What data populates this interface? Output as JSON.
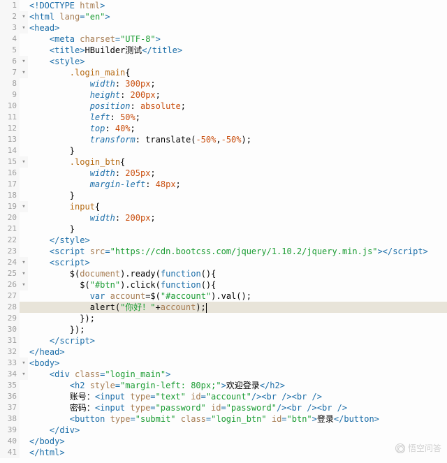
{
  "watermark": "悟空问答",
  "numbers": [
    "1",
    "2",
    "3",
    "4",
    "5",
    "6",
    "7",
    "8",
    "9",
    "10",
    "11",
    "12",
    "13",
    "14",
    "15",
    "16",
    "17",
    "18",
    "19",
    "20",
    "21",
    "22",
    "23",
    "24",
    "25",
    "26",
    "27",
    "28",
    "29",
    "30",
    "31",
    "32",
    "33",
    "34",
    "35",
    "36",
    "37",
    "38",
    "39",
    "40",
    "41"
  ],
  "fold": [
    0,
    1,
    1,
    0,
    0,
    1,
    1,
    0,
    0,
    0,
    0,
    0,
    0,
    0,
    1,
    0,
    0,
    0,
    1,
    0,
    0,
    0,
    0,
    1,
    1,
    1,
    0,
    0,
    0,
    0,
    0,
    0,
    1,
    1,
    0,
    0,
    0,
    0,
    0,
    0,
    0
  ],
  "current": 27,
  "lines": [
    [
      [
        "t-tag",
        "<!DOCTYPE "
      ],
      [
        "t-attr",
        "html"
      ],
      [
        "t-tag",
        ">"
      ]
    ],
    [
      [
        "t-tag",
        "<html "
      ],
      [
        "t-attr",
        "lang"
      ],
      [
        "t-tag",
        "="
      ],
      [
        "t-str",
        "\"en\""
      ],
      [
        "t-tag",
        ">"
      ]
    ],
    [
      [
        "t-tag",
        "<head>"
      ]
    ],
    [
      [
        "t-plain",
        "    "
      ],
      [
        "t-tag",
        "<meta "
      ],
      [
        "t-attr",
        "charset"
      ],
      [
        "t-tag",
        "="
      ],
      [
        "t-str",
        "\"UTF-8\""
      ],
      [
        "t-tag",
        ">"
      ]
    ],
    [
      [
        "t-plain",
        "    "
      ],
      [
        "t-tag",
        "<title>"
      ],
      [
        "t-plain",
        "HBuilder测试"
      ],
      [
        "t-tag",
        "</title>"
      ]
    ],
    [
      [
        "t-plain",
        "    "
      ],
      [
        "t-tag",
        "<style>"
      ]
    ],
    [
      [
        "t-plain",
        "        "
      ],
      [
        "t-sel",
        ".login_main"
      ],
      [
        "t-punct",
        "{"
      ]
    ],
    [
      [
        "t-plain",
        "            "
      ],
      [
        "t-prop",
        "width"
      ],
      [
        "t-punct",
        ": "
      ],
      [
        "t-num",
        "300"
      ],
      [
        "t-val",
        "px"
      ],
      [
        "t-punct",
        ";"
      ]
    ],
    [
      [
        "t-plain",
        "            "
      ],
      [
        "t-prop",
        "height"
      ],
      [
        "t-punct",
        ": "
      ],
      [
        "t-num",
        "200"
      ],
      [
        "t-val",
        "px"
      ],
      [
        "t-punct",
        ";"
      ]
    ],
    [
      [
        "t-plain",
        "            "
      ],
      [
        "t-prop",
        "position"
      ],
      [
        "t-punct",
        ": "
      ],
      [
        "t-val",
        "absolute"
      ],
      [
        "t-punct",
        ";"
      ]
    ],
    [
      [
        "t-plain",
        "            "
      ],
      [
        "t-prop",
        "left"
      ],
      [
        "t-punct",
        ": "
      ],
      [
        "t-num",
        "50"
      ],
      [
        "t-val",
        "%"
      ],
      [
        "t-punct",
        ";"
      ]
    ],
    [
      [
        "t-plain",
        "            "
      ],
      [
        "t-prop",
        "top"
      ],
      [
        "t-punct",
        ": "
      ],
      [
        "t-num",
        "40"
      ],
      [
        "t-val",
        "%"
      ],
      [
        "t-punct",
        ";"
      ]
    ],
    [
      [
        "t-plain",
        "            "
      ],
      [
        "t-prop",
        "transform"
      ],
      [
        "t-punct",
        ": "
      ],
      [
        "t-func",
        "translate"
      ],
      [
        "t-punct",
        "("
      ],
      [
        "t-num",
        "-50"
      ],
      [
        "t-val",
        "%"
      ],
      [
        "t-punct",
        ","
      ],
      [
        "t-num",
        "-50"
      ],
      [
        "t-val",
        "%"
      ],
      [
        "t-punct",
        ");"
      ]
    ],
    [
      [
        "t-plain",
        "        "
      ],
      [
        "t-punct",
        "}"
      ]
    ],
    [
      [
        "t-plain",
        "        "
      ],
      [
        "t-sel",
        ".login_btn"
      ],
      [
        "t-punct",
        "{"
      ]
    ],
    [
      [
        "t-plain",
        "            "
      ],
      [
        "t-prop",
        "width"
      ],
      [
        "t-punct",
        ": "
      ],
      [
        "t-num",
        "205"
      ],
      [
        "t-val",
        "px"
      ],
      [
        "t-punct",
        ";"
      ]
    ],
    [
      [
        "t-plain",
        "            "
      ],
      [
        "t-prop",
        "margin-left"
      ],
      [
        "t-punct",
        ": "
      ],
      [
        "t-num",
        "48"
      ],
      [
        "t-val",
        "px"
      ],
      [
        "t-punct",
        ";"
      ]
    ],
    [
      [
        "t-plain",
        "        "
      ],
      [
        "t-punct",
        "}"
      ]
    ],
    [
      [
        "t-plain",
        "        "
      ],
      [
        "t-sel",
        "input"
      ],
      [
        "t-punct",
        "{"
      ]
    ],
    [
      [
        "t-plain",
        "            "
      ],
      [
        "t-prop",
        "width"
      ],
      [
        "t-punct",
        ": "
      ],
      [
        "t-num",
        "200"
      ],
      [
        "t-val",
        "px"
      ],
      [
        "t-punct",
        ";"
      ]
    ],
    [
      [
        "t-plain",
        "        "
      ],
      [
        "t-punct",
        "}"
      ]
    ],
    [
      [
        "t-plain",
        "    "
      ],
      [
        "t-tag",
        "</style>"
      ]
    ],
    [
      [
        "t-plain",
        "    "
      ],
      [
        "t-tag",
        "<script "
      ],
      [
        "t-attr",
        "src"
      ],
      [
        "t-tag",
        "="
      ],
      [
        "t-str",
        "\"https://cdn.bootcss.com/jquery/1.10.2/jquery.min.js\""
      ],
      [
        "t-tag",
        "></script>"
      ]
    ],
    [
      [
        "t-plain",
        "    "
      ],
      [
        "t-tag",
        "<script>"
      ]
    ],
    [
      [
        "t-plain",
        "        "
      ],
      [
        "t-func",
        "$"
      ],
      [
        "t-punct",
        "("
      ],
      [
        "t-var",
        "document"
      ],
      [
        "t-punct",
        ")."
      ],
      [
        "t-func",
        "ready"
      ],
      [
        "t-punct",
        "("
      ],
      [
        "t-kw",
        "function"
      ],
      [
        "t-punct",
        "(){"
      ]
    ],
    [
      [
        "t-plain",
        "          "
      ],
      [
        "t-func",
        "$"
      ],
      [
        "t-punct",
        "("
      ],
      [
        "t-str",
        "\"#btn\""
      ],
      [
        "t-punct",
        ")."
      ],
      [
        "t-func",
        "click"
      ],
      [
        "t-punct",
        "("
      ],
      [
        "t-kw",
        "function"
      ],
      [
        "t-punct",
        "(){"
      ]
    ],
    [
      [
        "t-plain",
        "            "
      ],
      [
        "t-kw",
        "var "
      ],
      [
        "t-var",
        "account"
      ],
      [
        "t-punct",
        "="
      ],
      [
        "t-func",
        "$"
      ],
      [
        "t-punct",
        "("
      ],
      [
        "t-str",
        "\"#account\""
      ],
      [
        "t-punct",
        ")."
      ],
      [
        "t-func",
        "val"
      ],
      [
        "t-punct",
        "();"
      ]
    ],
    [
      [
        "t-plain",
        "            "
      ],
      [
        "t-func",
        "alert"
      ],
      [
        "t-punct",
        "("
      ],
      [
        "t-str",
        "\"你好！\""
      ],
      [
        "t-punct",
        "+"
      ],
      [
        "t-var",
        "account"
      ],
      [
        "t-punct",
        ");"
      ],
      [
        "cursor",
        ""
      ]
    ],
    [
      [
        "t-plain",
        "          "
      ],
      [
        "t-punct",
        "});"
      ]
    ],
    [
      [
        "t-plain",
        "        "
      ],
      [
        "t-punct",
        "});"
      ]
    ],
    [
      [
        "t-plain",
        "    "
      ],
      [
        "t-tag",
        "</script>"
      ]
    ],
    [
      [
        "t-tag",
        "</head>"
      ]
    ],
    [
      [
        "t-tag",
        "<body>"
      ]
    ],
    [
      [
        "t-plain",
        "    "
      ],
      [
        "t-tag",
        "<div "
      ],
      [
        "t-attr",
        "class"
      ],
      [
        "t-tag",
        "="
      ],
      [
        "t-str",
        "\"login_main\""
      ],
      [
        "t-tag",
        ">"
      ]
    ],
    [
      [
        "t-plain",
        "        "
      ],
      [
        "t-tag",
        "<h2 "
      ],
      [
        "t-attr",
        "style"
      ],
      [
        "t-tag",
        "="
      ],
      [
        "t-str",
        "\"margin-left: 80px;\""
      ],
      [
        "t-tag",
        ">"
      ],
      [
        "t-plain",
        "欢迎登录"
      ],
      [
        "t-tag",
        "</h2>"
      ]
    ],
    [
      [
        "t-plain",
        "        "
      ],
      [
        "t-cn",
        "账号："
      ],
      [
        "t-tag",
        "<input "
      ],
      [
        "t-attr",
        "type"
      ],
      [
        "t-tag",
        "="
      ],
      [
        "t-str",
        "\"text\""
      ],
      [
        "t-tag",
        " "
      ],
      [
        "t-attr",
        "id"
      ],
      [
        "t-tag",
        "="
      ],
      [
        "t-str",
        "\"account\""
      ],
      [
        "t-tag",
        "/><br /><br />"
      ]
    ],
    [
      [
        "t-plain",
        "        "
      ],
      [
        "t-cn",
        "密码："
      ],
      [
        "t-tag",
        "<input "
      ],
      [
        "t-attr",
        "type"
      ],
      [
        "t-tag",
        "="
      ],
      [
        "t-str",
        "\"password\""
      ],
      [
        "t-tag",
        " "
      ],
      [
        "t-attr",
        "id"
      ],
      [
        "t-tag",
        "="
      ],
      [
        "t-str",
        "\"password\""
      ],
      [
        "t-tag",
        "/><br /><br />"
      ]
    ],
    [
      [
        "t-plain",
        "        "
      ],
      [
        "t-tag",
        "<button "
      ],
      [
        "t-attr",
        "type"
      ],
      [
        "t-tag",
        "="
      ],
      [
        "t-str",
        "\"submit\""
      ],
      [
        "t-tag",
        " "
      ],
      [
        "t-attr",
        "class"
      ],
      [
        "t-tag",
        "="
      ],
      [
        "t-str",
        "\"login_btn\""
      ],
      [
        "t-tag",
        " "
      ],
      [
        "t-attr",
        "id"
      ],
      [
        "t-tag",
        "="
      ],
      [
        "t-str",
        "\"btn\""
      ],
      [
        "t-tag",
        ">"
      ],
      [
        "t-plain",
        "登录"
      ],
      [
        "t-tag",
        "</button>"
      ]
    ],
    [
      [
        "t-plain",
        "    "
      ],
      [
        "t-tag",
        "</div>"
      ]
    ],
    [
      [
        "t-tag",
        "</body>"
      ]
    ],
    [
      [
        "t-tag",
        "</html>"
      ]
    ]
  ]
}
